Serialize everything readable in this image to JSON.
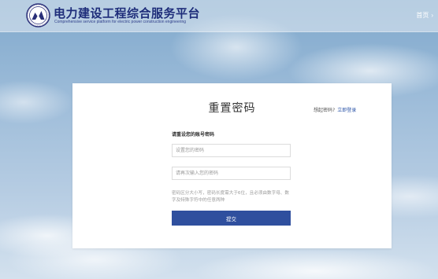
{
  "header": {
    "title": "电力建设工程综合服务平台",
    "subtitle": "Comprehensive service platform for electric power construction engineering",
    "logo_icon": "association-seal-logo",
    "home_label": "首页",
    "home_chevron": "›"
  },
  "card": {
    "title": "重置密码",
    "login_hint": "想起密码?",
    "login_link": "立即登录",
    "section_label": "请重设您的账号密码",
    "password_placeholder": "设置您的密码",
    "confirm_placeholder": "请再次输入您的密码",
    "hint": "密码区分大小写，密码长度需大于6位，且必须由数字母、数字及特殊字符中的任意两种",
    "submit_label": "提交"
  },
  "colors": {
    "brand_navy": "#1e2d7a",
    "button_blue": "#2f4f9e",
    "link_blue": "#2c55a8"
  }
}
